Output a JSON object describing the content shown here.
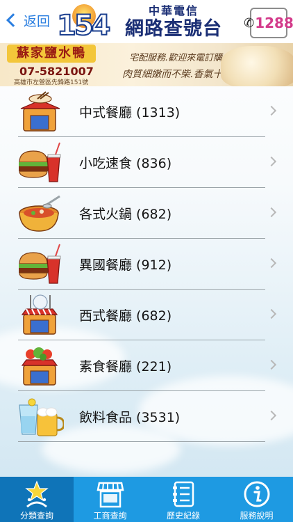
{
  "header": {
    "back_label": "返回",
    "logo_number": "154",
    "brand_sub": "中華電信",
    "brand_main": "網路查號台",
    "tel_label": "1288"
  },
  "ad": {
    "shop_name": "蘇家鹽水鴨",
    "phone": "07-5821007",
    "address": "高雄市左營區先鋒路151號",
    "line1": "宅配服務.歡迎來電訂購",
    "line2": "肉質細嫩而不柴.香氣十足"
  },
  "categories": [
    {
      "label": "中式餐廳 (1313)",
      "icon": "chinese-restaurant-icon"
    },
    {
      "label": "小吃速食 (836)",
      "icon": "burger-drink-icon"
    },
    {
      "label": "各式火鍋 (682)",
      "icon": "hotpot-icon"
    },
    {
      "label": "異國餐廳 (912)",
      "icon": "burger-drink-icon"
    },
    {
      "label": "西式餐廳 (682)",
      "icon": "western-restaurant-icon"
    },
    {
      "label": "素食餐廳 (221)",
      "icon": "vegetarian-restaurant-icon"
    },
    {
      "label": "飲料食品 (3531)",
      "icon": "beverage-icon"
    }
  ],
  "tabs": [
    {
      "label": "分類查詢",
      "icon": "category-star-icon",
      "active": true
    },
    {
      "label": "工商查詢",
      "icon": "storefront-icon",
      "active": false
    },
    {
      "label": "歷史紀錄",
      "icon": "history-list-icon",
      "active": false
    },
    {
      "label": "服務說明",
      "icon": "info-icon",
      "active": false
    }
  ],
  "colors": {
    "accent": "#2a7ee0",
    "tabbar": "#1e9ae2",
    "tab_active": "#0f74b8"
  }
}
